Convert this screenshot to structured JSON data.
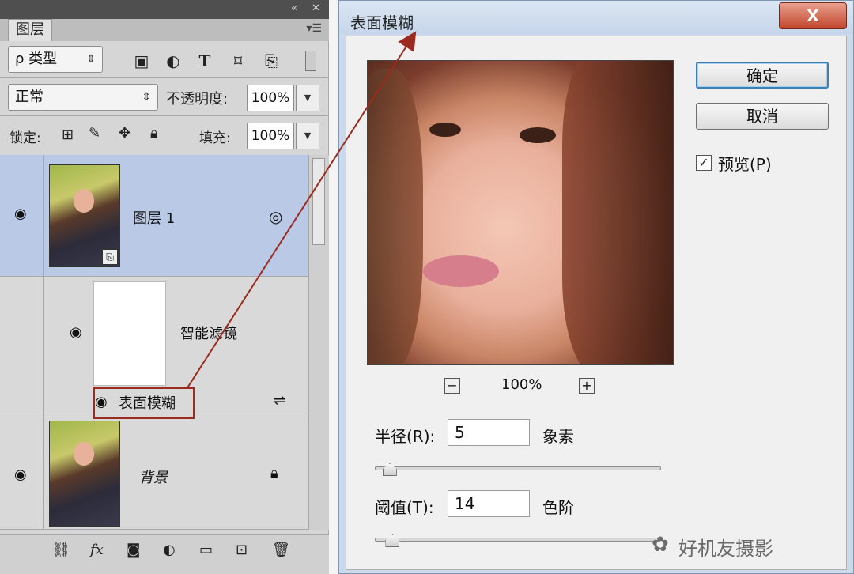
{
  "layers_panel": {
    "tab_label": "图层",
    "filter_select": "ρ 类型",
    "blend_mode": "正常",
    "opacity_label": "不透明度:",
    "opacity_value": "100%",
    "lock_label": "锁定:",
    "fill_label": "填充:",
    "fill_value": "100%",
    "layers": [
      {
        "name": "图层 1",
        "visible": true
      },
      {
        "name": "智能滤镜",
        "visible": true
      },
      {
        "name": "表面模糊",
        "visible": true
      },
      {
        "name": "背景",
        "visible": true
      }
    ]
  },
  "dialog": {
    "title": "表面模糊",
    "close_label": "X",
    "ok_label": "确定",
    "cancel_label": "取消",
    "preview_label": "预览(P)",
    "preview_checked": true,
    "zoom": "100%",
    "zoom_minus": "−",
    "zoom_plus": "+",
    "radius_label": "半径(R):",
    "radius_value": "5",
    "radius_unit": "象素",
    "threshold_label": "阈值(T):",
    "threshold_value": "14",
    "threshold_unit": "色阶",
    "radius_slider_fraction": 0.03,
    "threshold_slider_fraction": 0.04
  },
  "watermark": "好机友摄影",
  "colors": {
    "highlight": "#9b2a1f",
    "selected_layer": "#b9c9e6",
    "close_button": "#c2452c"
  }
}
